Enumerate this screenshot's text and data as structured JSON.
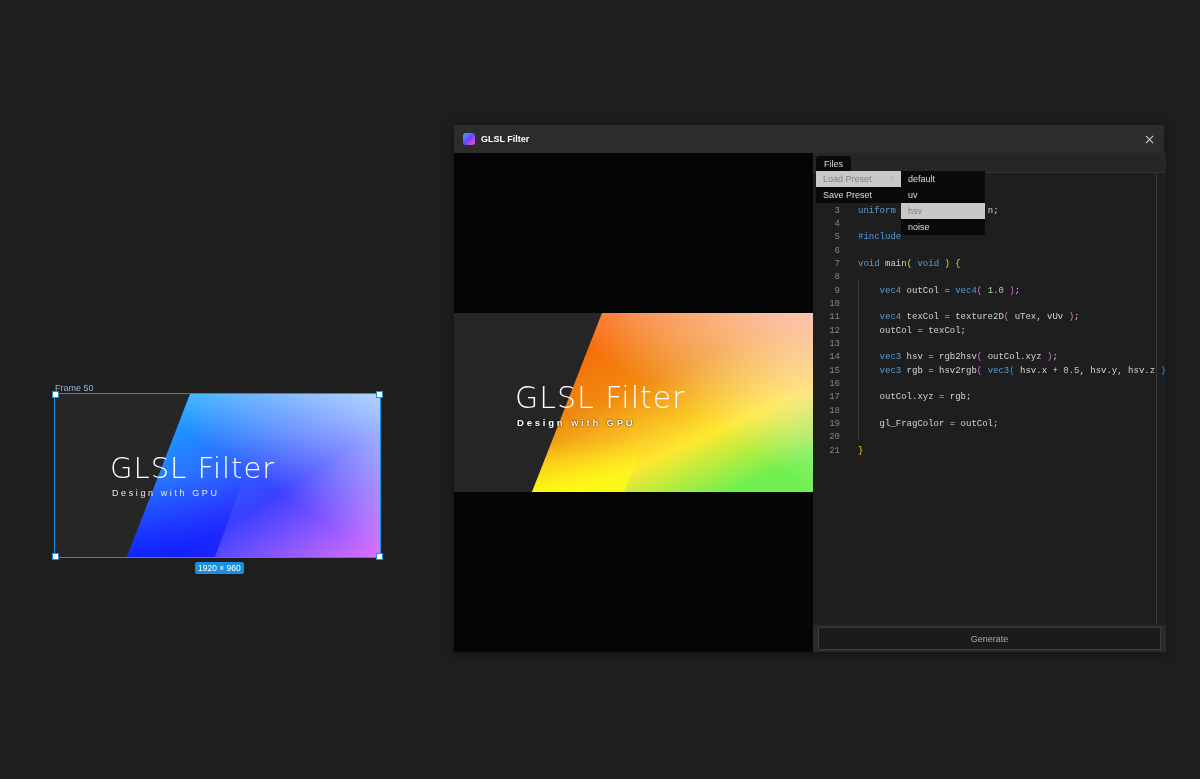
{
  "canvas": {
    "frame": {
      "label": "Frame 50",
      "title": "GLSL Filter",
      "subtitle": "Design with GPU",
      "size": "1920 × 960",
      "selected": true
    }
  },
  "window": {
    "title": "GLSL Filter"
  },
  "preview": {
    "title": "GLSL Filter",
    "subtitle": "Design with GPU"
  },
  "editor": {
    "tabs": [
      {
        "label": "Files",
        "selected": true
      }
    ],
    "menu": {
      "items": [
        {
          "label": "Load Preset",
          "selected": true,
          "submenu": true
        },
        {
          "label": "Save Preset",
          "selected": false,
          "submenu": false
        }
      ],
      "submenu": [
        {
          "label": "default",
          "selected": false
        },
        {
          "label": "uv",
          "selected": false
        },
        {
          "label": "hsv",
          "selected": true
        },
        {
          "label": "noise",
          "selected": false
        }
      ]
    },
    "lines": [
      {
        "number": "3",
        "tokens": [
          {
            "kind": "kw",
            "t": "uniform"
          }
        ],
        "tail": [
          {
            "kind": "plain",
            "t": "n;"
          }
        ]
      },
      {
        "number": "4"
      },
      {
        "number": "5",
        "tokens": [
          {
            "kind": "kw",
            "t": "#include"
          }
        ]
      },
      {
        "number": "6"
      },
      {
        "number": "7",
        "tokens": [
          {
            "kind": "kw",
            "t": "void"
          },
          {
            "kind": "plain",
            "t": " main"
          },
          {
            "kind": "p1",
            "t": "("
          },
          {
            "kind": "kw",
            "t": " void "
          },
          {
            "kind": "p1",
            "t": ")"
          },
          {
            "kind": "p1",
            "t": " {"
          }
        ]
      },
      {
        "number": "8"
      },
      {
        "number": "9",
        "indent": true,
        "tokens": [
          {
            "kind": "kw",
            "t": "vec4"
          },
          {
            "kind": "plain",
            "t": " outCol = "
          },
          {
            "kind": "kw",
            "t": "vec4"
          },
          {
            "kind": "p2",
            "t": "("
          },
          {
            "kind": "num",
            "t": " 1.0 "
          },
          {
            "kind": "p2",
            "t": ")"
          },
          {
            "kind": "plain",
            "t": ";"
          }
        ]
      },
      {
        "number": "10"
      },
      {
        "number": "11",
        "indent": true,
        "tokens": [
          {
            "kind": "kw",
            "t": "vec4"
          },
          {
            "kind": "plain",
            "t": " texCol = texture2D"
          },
          {
            "kind": "p2",
            "t": "("
          },
          {
            "kind": "plain",
            "t": " uTex, vUv "
          },
          {
            "kind": "p2",
            "t": ")"
          },
          {
            "kind": "plain",
            "t": ";"
          }
        ]
      },
      {
        "number": "12",
        "indent": true,
        "tokens": [
          {
            "kind": "plain",
            "t": "outCol = texCol;"
          }
        ]
      },
      {
        "number": "13"
      },
      {
        "number": "14",
        "indent": true,
        "tokens": [
          {
            "kind": "kw",
            "t": "vec3"
          },
          {
            "kind": "plain",
            "t": " hsv = rgb2hsv"
          },
          {
            "kind": "p2",
            "t": "("
          },
          {
            "kind": "plain",
            "t": " outCol.xyz "
          },
          {
            "kind": "p2",
            "t": ")"
          },
          {
            "kind": "plain",
            "t": ";"
          }
        ]
      },
      {
        "number": "15",
        "indent": true,
        "tokens": [
          {
            "kind": "kw",
            "t": "vec3"
          },
          {
            "kind": "plain",
            "t": " rgb = hsv2rgb"
          },
          {
            "kind": "p2",
            "t": "("
          },
          {
            "kind": "kw",
            "t": " vec3"
          },
          {
            "kind": "p3",
            "t": "("
          },
          {
            "kind": "plain",
            "t": " hsv.x + "
          },
          {
            "kind": "num",
            "t": "0.5"
          },
          {
            "kind": "plain",
            "t": ", hsv.y, hsv.z "
          },
          {
            "kind": "p3",
            "t": ")"
          }
        ]
      },
      {
        "number": "16"
      },
      {
        "number": "17",
        "indent": true,
        "tokens": [
          {
            "kind": "plain",
            "t": "outCol.xyz = rgb;"
          }
        ]
      },
      {
        "number": "18"
      },
      {
        "number": "19",
        "indent": true,
        "tokens": [
          {
            "kind": "plain",
            "t": "gl_FragColor = outCol;"
          }
        ]
      },
      {
        "number": "20"
      },
      {
        "number": "21",
        "tokens": [
          {
            "kind": "p1",
            "t": "}"
          }
        ]
      }
    ]
  },
  "generate": "Generate"
}
